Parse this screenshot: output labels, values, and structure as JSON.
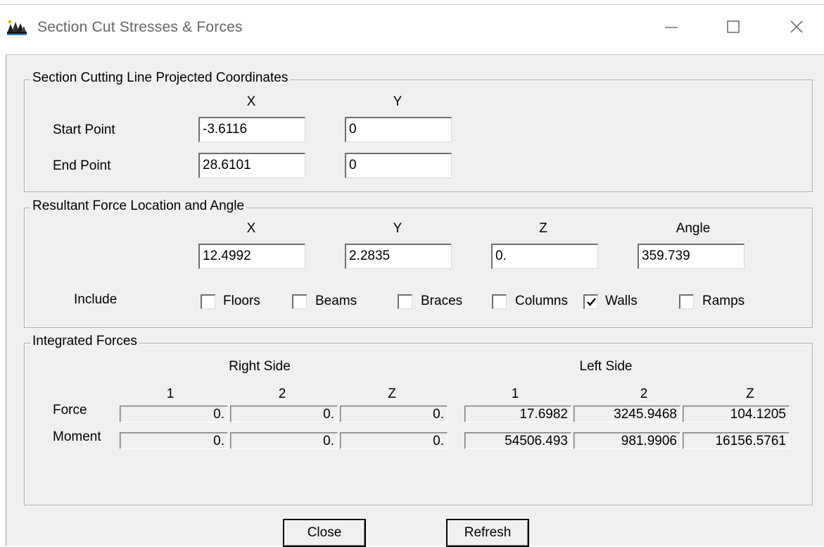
{
  "window": {
    "title": "Section Cut Stresses & Forces",
    "controls": {
      "minimize_icon": "minimize-icon",
      "maximize_icon": "maximize-icon",
      "close_icon": "close-icon"
    }
  },
  "section_cut": {
    "legend": "Section Cutting Line Projected Coordinates",
    "col_x": "X",
    "col_y": "Y",
    "start_label": "Start Point",
    "end_label": "End Point",
    "start_x": "-3.6116",
    "start_y": "0",
    "end_x": "28.6101",
    "end_y": "0"
  },
  "resultant": {
    "legend": "Resultant Force Location and Angle",
    "col_x": "X",
    "col_y": "Y",
    "col_z": "Z",
    "col_angle": "Angle",
    "x": "12.4992",
    "y": "2.2835",
    "z": "0.",
    "angle": "359.739",
    "include_label": "Include",
    "include": [
      {
        "label": "Floors",
        "checked": false
      },
      {
        "label": "Beams",
        "checked": false
      },
      {
        "label": "Braces",
        "checked": false
      },
      {
        "label": "Columns",
        "checked": false
      },
      {
        "label": "Walls",
        "checked": true
      },
      {
        "label": "Ramps",
        "checked": false
      }
    ]
  },
  "integrated": {
    "legend": "Integrated Forces",
    "right_side": "Right Side",
    "left_side": "Left Side",
    "cols": [
      "1",
      "2",
      "Z",
      "1",
      "2",
      "Z"
    ],
    "force_label": "Force",
    "moment_label": "Moment",
    "force": [
      "0.",
      "0.",
      "0.",
      "17.6982",
      "3245.9468",
      "104.1205"
    ],
    "moment": [
      "0.",
      "0.",
      "0.",
      "54506.493",
      "981.9906",
      "16156.5761"
    ]
  },
  "buttons": {
    "close": "Close",
    "refresh": "Refresh"
  }
}
